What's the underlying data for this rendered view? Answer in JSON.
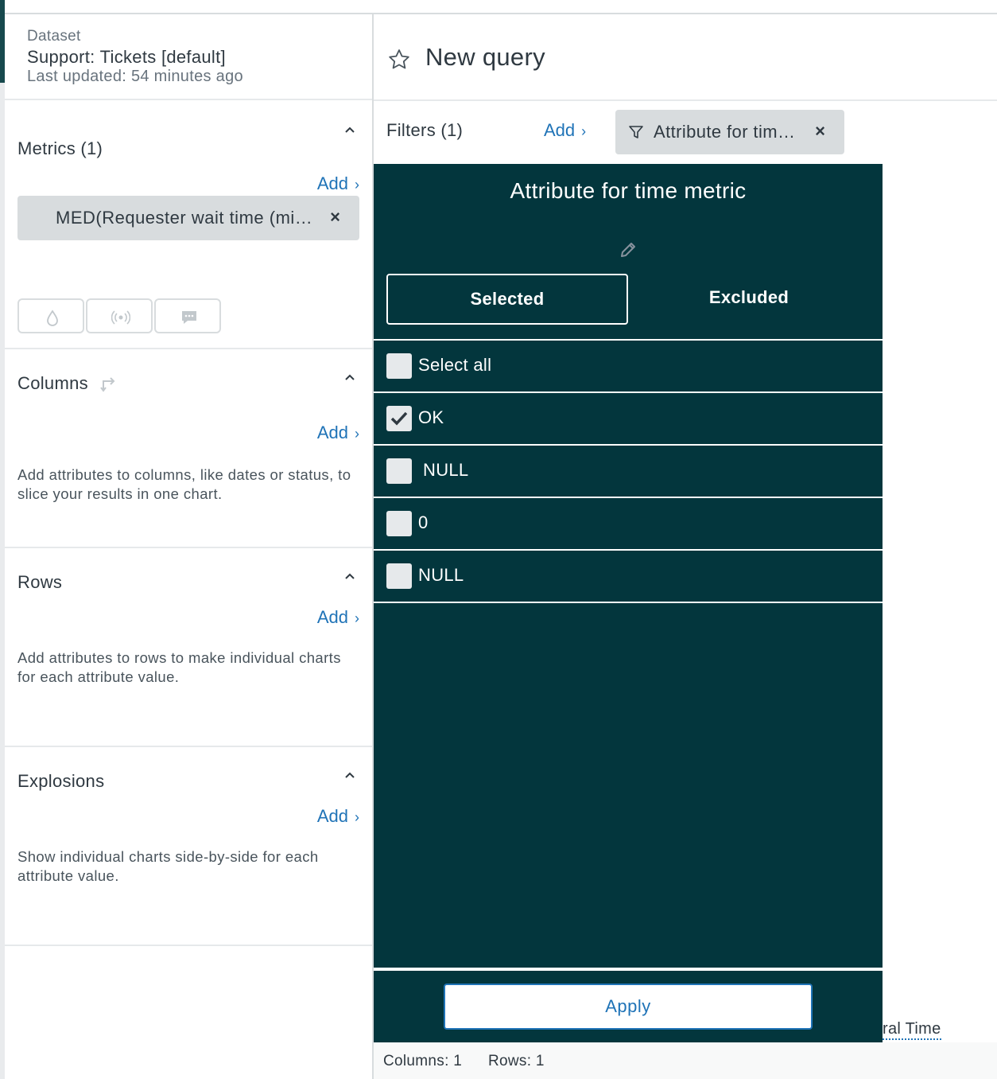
{
  "dataset": {
    "label": "Dataset",
    "name": "Support: Tickets [default]",
    "updated": "Last updated: 54 minutes ago"
  },
  "query": {
    "title": "New query"
  },
  "metrics": {
    "title": "Metrics (1)",
    "add": "Add",
    "pill": "MED(Requester wait time (mi…",
    "remove": "×"
  },
  "columns": {
    "title": "Columns",
    "add": "Add",
    "desc": "Add attributes to columns, like dates or status, to slice your results in one chart."
  },
  "rows": {
    "title": "Rows",
    "add": "Add",
    "desc": "Add attributes to rows to make individual charts for each attribute value."
  },
  "explosions": {
    "title": "Explosions",
    "add": "Add",
    "desc": "Show individual charts side-by-side for each attribute value."
  },
  "filters": {
    "title": "Filters (1)",
    "add": "Add",
    "chip": "Attribute for tim…",
    "remove": "×"
  },
  "popover": {
    "title": "Attribute for time metric",
    "tab_selected": "Selected",
    "tab_excluded": "Excluded",
    "options": [
      {
        "label": "Select all",
        "checked": false
      },
      {
        "label": "OK",
        "checked": true
      },
      {
        "label": "NULL",
        "checked": false
      },
      {
        "label": "0",
        "checked": false
      },
      {
        "label": "NULL",
        "checked": false
      }
    ],
    "apply": "Apply"
  },
  "background_link": "ral Time",
  "status": {
    "columns": "Columns: 1",
    "rows": "Rows: 1"
  }
}
